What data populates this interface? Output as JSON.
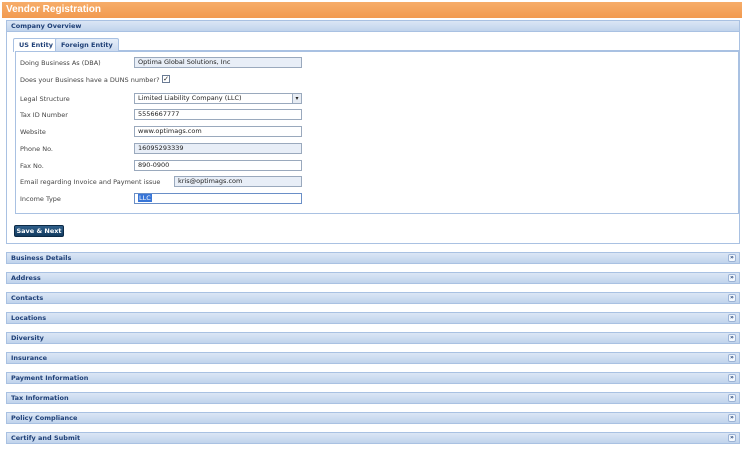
{
  "title": "Vendor Registration",
  "overview": {
    "header": "Company Overview",
    "tabs": [
      "US Entity",
      "Foreign Entity"
    ],
    "fields": {
      "dba_label": "Doing Business As (DBA)",
      "dba_value": "Optima Global Solutions, Inc",
      "duns_label": "Does your Business have a DUNS number?",
      "duns_check": "✓",
      "legal_label": "Legal Structure",
      "legal_value": "Limited Liability Company (LLC)",
      "taxid_label": "Tax ID Number",
      "taxid_value": "5556667777",
      "website_label": "Website",
      "website_value": "www.optimags.com",
      "phone_label": "Phone No.",
      "phone_value": "16095293339",
      "fax_label": "Fax No.",
      "fax_value": "890-0900",
      "email_label": "Email regarding Invoice and Payment issue",
      "email_value": "kris@optimags.com",
      "income_label": "Income Type",
      "income_value": "LLC"
    },
    "save_button": "Save & Next"
  },
  "sections": [
    "Business Details",
    "Address",
    "Contacts",
    "Locations",
    "Diversity",
    "Insurance",
    "Payment Information",
    "Tax Information",
    "Policy Compliance",
    "Certify and Submit"
  ],
  "icons": {
    "chevron": "chevron-down-icon",
    "select_arrow": "dropdown-arrow-icon"
  },
  "colors": {
    "title_bar": "#f29a4f",
    "section_text": "#1e3f76",
    "button": "#123a5f"
  }
}
